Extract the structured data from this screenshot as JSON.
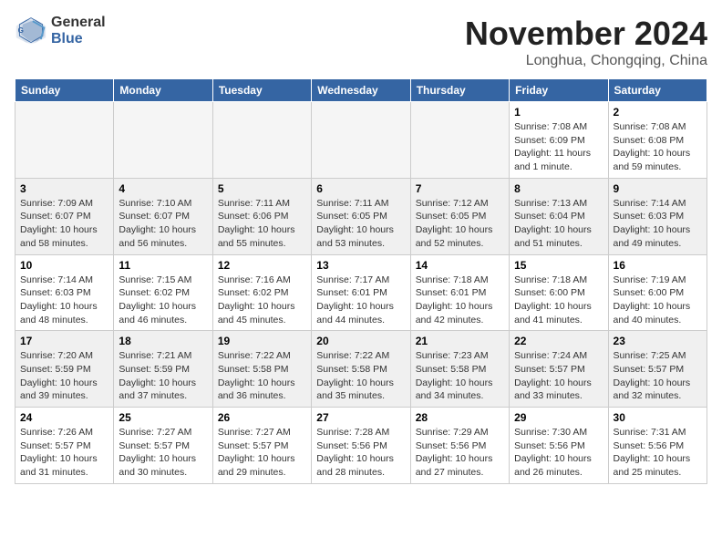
{
  "header": {
    "logo_line1": "General",
    "logo_line2": "Blue",
    "month": "November 2024",
    "location": "Longhua, Chongqing, China"
  },
  "days_of_week": [
    "Sunday",
    "Monday",
    "Tuesday",
    "Wednesday",
    "Thursday",
    "Friday",
    "Saturday"
  ],
  "weeks": [
    [
      {
        "day": "",
        "info": ""
      },
      {
        "day": "",
        "info": ""
      },
      {
        "day": "",
        "info": ""
      },
      {
        "day": "",
        "info": ""
      },
      {
        "day": "",
        "info": ""
      },
      {
        "day": "1",
        "info": "Sunrise: 7:08 AM\nSunset: 6:09 PM\nDaylight: 11 hours and 1 minute."
      },
      {
        "day": "2",
        "info": "Sunrise: 7:08 AM\nSunset: 6:08 PM\nDaylight: 10 hours and 59 minutes."
      }
    ],
    [
      {
        "day": "3",
        "info": "Sunrise: 7:09 AM\nSunset: 6:07 PM\nDaylight: 10 hours and 58 minutes."
      },
      {
        "day": "4",
        "info": "Sunrise: 7:10 AM\nSunset: 6:07 PM\nDaylight: 10 hours and 56 minutes."
      },
      {
        "day": "5",
        "info": "Sunrise: 7:11 AM\nSunset: 6:06 PM\nDaylight: 10 hours and 55 minutes."
      },
      {
        "day": "6",
        "info": "Sunrise: 7:11 AM\nSunset: 6:05 PM\nDaylight: 10 hours and 53 minutes."
      },
      {
        "day": "7",
        "info": "Sunrise: 7:12 AM\nSunset: 6:05 PM\nDaylight: 10 hours and 52 minutes."
      },
      {
        "day": "8",
        "info": "Sunrise: 7:13 AM\nSunset: 6:04 PM\nDaylight: 10 hours and 51 minutes."
      },
      {
        "day": "9",
        "info": "Sunrise: 7:14 AM\nSunset: 6:03 PM\nDaylight: 10 hours and 49 minutes."
      }
    ],
    [
      {
        "day": "10",
        "info": "Sunrise: 7:14 AM\nSunset: 6:03 PM\nDaylight: 10 hours and 48 minutes."
      },
      {
        "day": "11",
        "info": "Sunrise: 7:15 AM\nSunset: 6:02 PM\nDaylight: 10 hours and 46 minutes."
      },
      {
        "day": "12",
        "info": "Sunrise: 7:16 AM\nSunset: 6:02 PM\nDaylight: 10 hours and 45 minutes."
      },
      {
        "day": "13",
        "info": "Sunrise: 7:17 AM\nSunset: 6:01 PM\nDaylight: 10 hours and 44 minutes."
      },
      {
        "day": "14",
        "info": "Sunrise: 7:18 AM\nSunset: 6:01 PM\nDaylight: 10 hours and 42 minutes."
      },
      {
        "day": "15",
        "info": "Sunrise: 7:18 AM\nSunset: 6:00 PM\nDaylight: 10 hours and 41 minutes."
      },
      {
        "day": "16",
        "info": "Sunrise: 7:19 AM\nSunset: 6:00 PM\nDaylight: 10 hours and 40 minutes."
      }
    ],
    [
      {
        "day": "17",
        "info": "Sunrise: 7:20 AM\nSunset: 5:59 PM\nDaylight: 10 hours and 39 minutes."
      },
      {
        "day": "18",
        "info": "Sunrise: 7:21 AM\nSunset: 5:59 PM\nDaylight: 10 hours and 37 minutes."
      },
      {
        "day": "19",
        "info": "Sunrise: 7:22 AM\nSunset: 5:58 PM\nDaylight: 10 hours and 36 minutes."
      },
      {
        "day": "20",
        "info": "Sunrise: 7:22 AM\nSunset: 5:58 PM\nDaylight: 10 hours and 35 minutes."
      },
      {
        "day": "21",
        "info": "Sunrise: 7:23 AM\nSunset: 5:58 PM\nDaylight: 10 hours and 34 minutes."
      },
      {
        "day": "22",
        "info": "Sunrise: 7:24 AM\nSunset: 5:57 PM\nDaylight: 10 hours and 33 minutes."
      },
      {
        "day": "23",
        "info": "Sunrise: 7:25 AM\nSunset: 5:57 PM\nDaylight: 10 hours and 32 minutes."
      }
    ],
    [
      {
        "day": "24",
        "info": "Sunrise: 7:26 AM\nSunset: 5:57 PM\nDaylight: 10 hours and 31 minutes."
      },
      {
        "day": "25",
        "info": "Sunrise: 7:27 AM\nSunset: 5:57 PM\nDaylight: 10 hours and 30 minutes."
      },
      {
        "day": "26",
        "info": "Sunrise: 7:27 AM\nSunset: 5:57 PM\nDaylight: 10 hours and 29 minutes."
      },
      {
        "day": "27",
        "info": "Sunrise: 7:28 AM\nSunset: 5:56 PM\nDaylight: 10 hours and 28 minutes."
      },
      {
        "day": "28",
        "info": "Sunrise: 7:29 AM\nSunset: 5:56 PM\nDaylight: 10 hours and 27 minutes."
      },
      {
        "day": "29",
        "info": "Sunrise: 7:30 AM\nSunset: 5:56 PM\nDaylight: 10 hours and 26 minutes."
      },
      {
        "day": "30",
        "info": "Sunrise: 7:31 AM\nSunset: 5:56 PM\nDaylight: 10 hours and 25 minutes."
      }
    ]
  ]
}
